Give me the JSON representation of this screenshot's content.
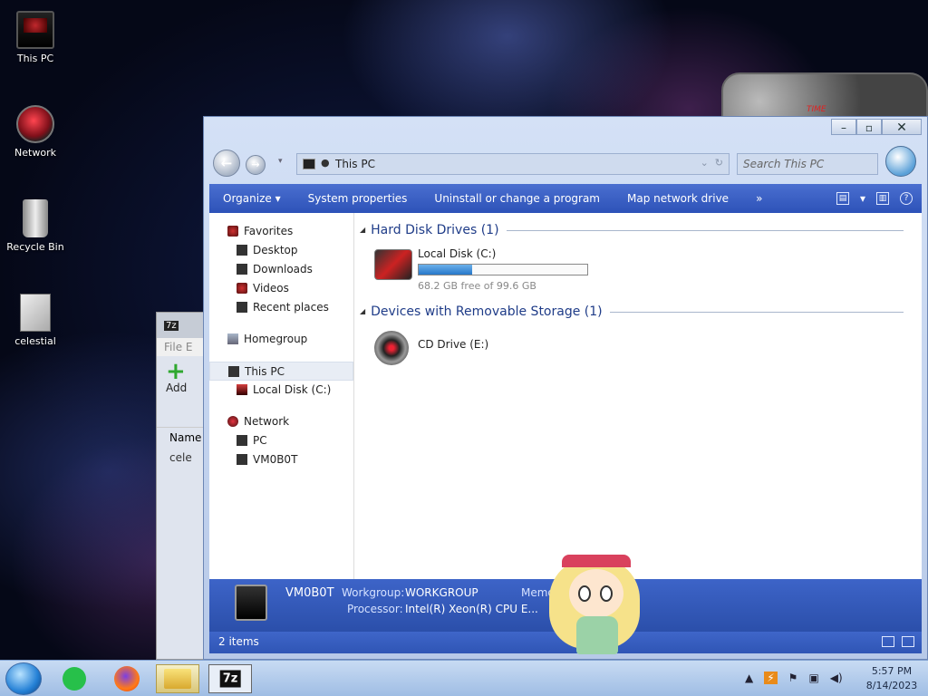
{
  "desktop": {
    "icons": [
      {
        "label": "This PC"
      },
      {
        "label": "Network"
      },
      {
        "label": "Recycle Bin"
      },
      {
        "label": "celestial"
      }
    ]
  },
  "zip_window": {
    "title_icon": "7z",
    "menu_file": "File",
    "menu_edit": "E",
    "add_label": "Add",
    "column_name": "Name",
    "row_name": "cele"
  },
  "widget": {
    "label": "TIME"
  },
  "explorer": {
    "address": "This PC",
    "search_placeholder": "Search This PC",
    "commands": [
      "Organize ▾",
      "System properties",
      "Uninstall or change a program",
      "Map network drive",
      "»"
    ],
    "sidebar": {
      "favorites": "Favorites",
      "desktop": "Desktop",
      "downloads": "Downloads",
      "videos": "Videos",
      "recent": "Recent places",
      "homegroup": "Homegroup",
      "this_pc": "This PC",
      "local_disk": "Local Disk (C:)",
      "network": "Network",
      "pc": "PC",
      "vm": "VM0B0T"
    },
    "groups": {
      "hdd_title": "Hard Disk Drives (1)",
      "removable_title": "Devices with Removable Storage (1)"
    },
    "local_disk": {
      "name": "Local Disk (C:)",
      "free_text": "68.2 GB free of 99.6 GB",
      "used_fraction": 0.315
    },
    "cd_drive": {
      "name": "CD Drive (E:)"
    },
    "details": {
      "computer_name": "VM0B0T",
      "workgroup_label": "Workgroup:",
      "workgroup_value": "WORKGROUP",
      "memory_label": "Memor",
      "processor_label": "Processor:",
      "processor_value": "Intel(R) Xeon(R) CPU E..."
    },
    "status": {
      "items": "2 items"
    }
  },
  "taskbar": {
    "zip_label": "7z",
    "time": "5:57 PM",
    "date": "8/14/2023"
  }
}
